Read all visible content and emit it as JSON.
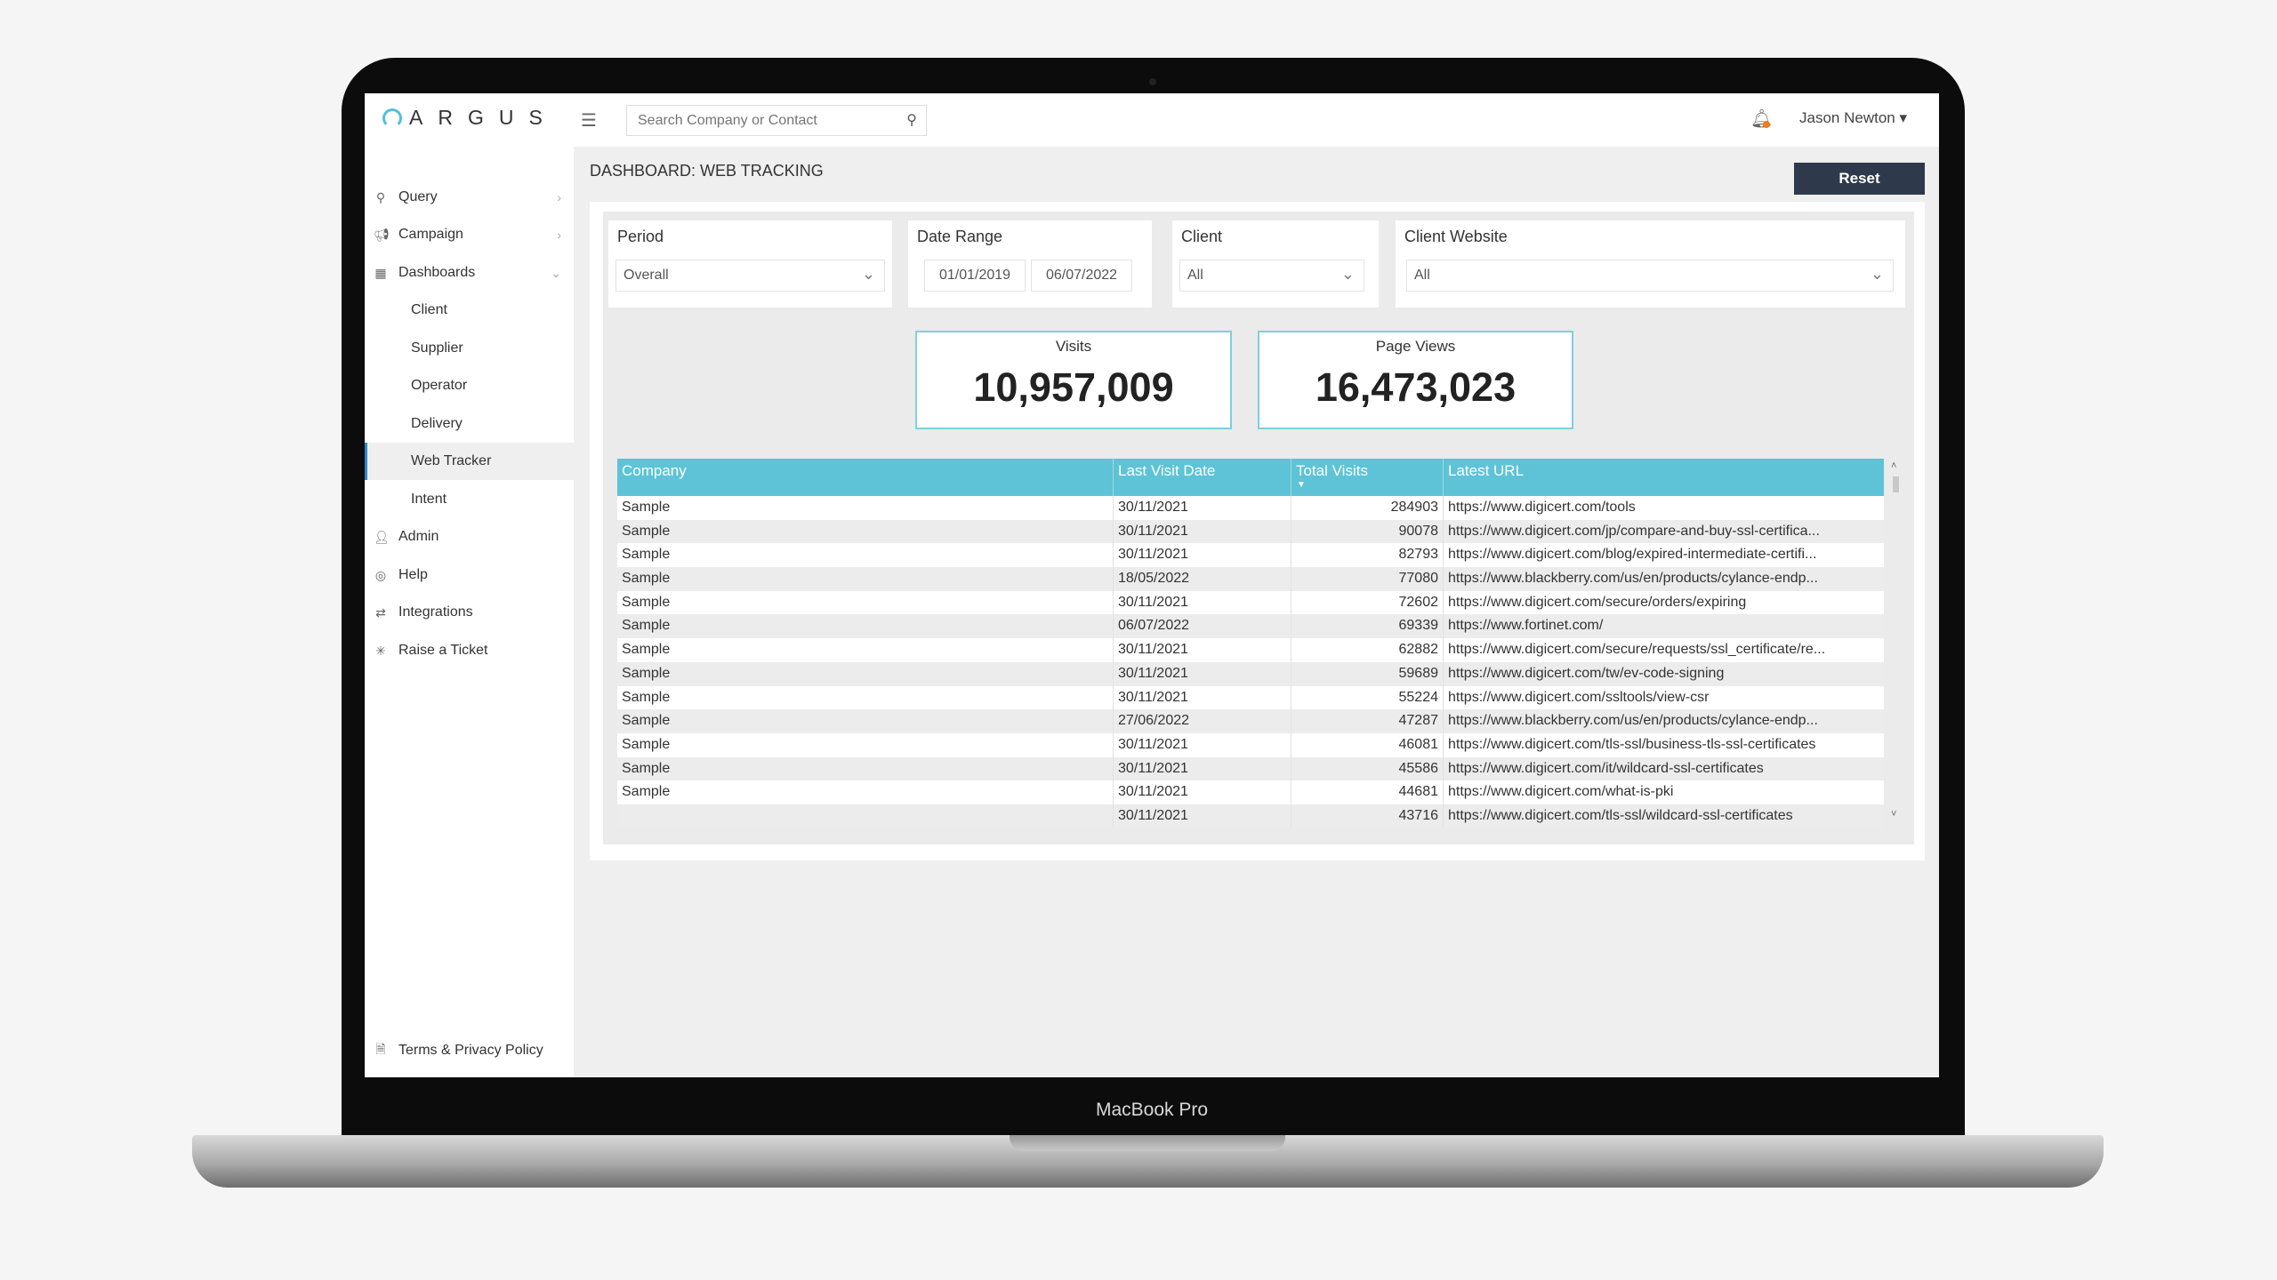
{
  "device": {
    "label": "MacBook Pro"
  },
  "header": {
    "logo": "ARGUS",
    "search_placeholder": "Search Company or Contact",
    "user_name": "Jason Newton ▾"
  },
  "sidebar": {
    "items": [
      {
        "label": "Query",
        "icon": "search-icon",
        "chevron": "›"
      },
      {
        "label": "Campaign",
        "icon": "megaphone-icon",
        "chevron": "›"
      },
      {
        "label": "Dashboards",
        "icon": "grid-icon",
        "chevron": "⌄"
      }
    ],
    "sub_items": [
      "Client",
      "Supplier",
      "Operator",
      "Delivery",
      "Web Tracker",
      "Intent"
    ],
    "active_sub_item": "Web Tracker",
    "lower_items": [
      {
        "label": "Admin",
        "icon": "user-icon"
      },
      {
        "label": "Help",
        "icon": "lifebuoy-icon"
      },
      {
        "label": "Integrations",
        "icon": "integrations-icon"
      },
      {
        "label": "Raise a Ticket",
        "icon": "asterisk-icon"
      }
    ],
    "footer": {
      "label": "Terms & Privacy Policy",
      "icon": "document-icon"
    }
  },
  "main": {
    "title": "DASHBOARD: WEB TRACKING",
    "reset_label": "Reset",
    "filters": {
      "period": {
        "label": "Period",
        "value": "Overall"
      },
      "date_range": {
        "label": "Date Range",
        "from": "01/01/2019",
        "to": "06/07/2022"
      },
      "client": {
        "label": "Client",
        "value": "All"
      },
      "client_website": {
        "label": "Client Website",
        "value": "All"
      }
    },
    "kpis": {
      "visits": {
        "label": "Visits",
        "value": "10,957,009"
      },
      "page_views": {
        "label": "Page Views",
        "value": "16,473,023"
      }
    },
    "table": {
      "columns": [
        "Company",
        "Last Visit Date",
        "Total Visits",
        "Latest URL"
      ],
      "sorted_column": "Total Visits",
      "sort_direction": "descending",
      "rows": [
        [
          "Sample",
          "30/11/2021",
          "284903",
          "https://www.digicert.com/tools"
        ],
        [
          "Sample",
          "30/11/2021",
          "90078",
          "https://www.digicert.com/jp/compare-and-buy-ssl-certifica..."
        ],
        [
          "Sample",
          "30/11/2021",
          "82793",
          "https://www.digicert.com/blog/expired-intermediate-certifi..."
        ],
        [
          "Sample",
          "18/05/2022",
          "77080",
          "https://www.blackberry.com/us/en/products/cylance-endp..."
        ],
        [
          "Sample",
          "30/11/2021",
          "72602",
          "https://www.digicert.com/secure/orders/expiring"
        ],
        [
          "Sample",
          "06/07/2022",
          "69339",
          "https://www.fortinet.com/"
        ],
        [
          "Sample",
          "30/11/2021",
          "62882",
          "https://www.digicert.com/secure/requests/ssl_certificate/re..."
        ],
        [
          "Sample",
          "30/11/2021",
          "59689",
          "https://www.digicert.com/tw/ev-code-signing"
        ],
        [
          "Sample",
          "30/11/2021",
          "55224",
          "https://www.digicert.com/ssltools/view-csr"
        ],
        [
          "Sample",
          "27/06/2022",
          "47287",
          "https://www.blackberry.com/us/en/products/cylance-endp..."
        ],
        [
          "Sample",
          "30/11/2021",
          "46081",
          "https://www.digicert.com/tls-ssl/business-tls-ssl-certificates"
        ],
        [
          "Sample",
          "30/11/2021",
          "45586",
          "https://www.digicert.com/it/wildcard-ssl-certificates"
        ],
        [
          "Sample",
          "30/11/2021",
          "44681",
          "https://www.digicert.com/what-is-pki"
        ],
        [
          "",
          "30/11/2021",
          "43716",
          "https://www.digicert.com/tls-ssl/wildcard-ssl-certificates"
        ]
      ]
    }
  },
  "colors": {
    "accent": "#5ec3d6",
    "reset_button": "#2e3a4b",
    "notification_dot": "#f07c1b",
    "logo": "#4fc1d8"
  }
}
